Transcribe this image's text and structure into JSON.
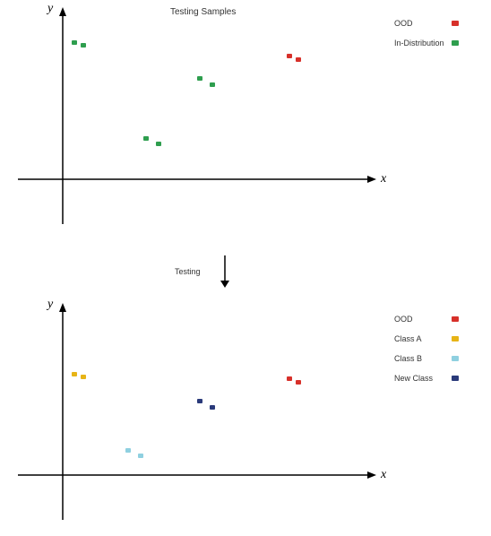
{
  "chart_data": [
    {
      "type": "scatter",
      "title": "Testing Samples",
      "xlabel": "x",
      "ylabel": "y",
      "xlim": [
        -3,
        12
      ],
      "ylim": [
        -3,
        7
      ],
      "series": [
        {
          "name": "OOD",
          "color": "#d7302a",
          "points": [
            [
              9.2,
              4.3
            ],
            [
              9.6,
              4.1
            ]
          ]
        },
        {
          "name": "In-Distribution",
          "color": "#2e9e4e",
          "points": [
            [
              -1.5,
              5.1
            ],
            [
              -1.1,
              5.0
            ],
            [
              5.2,
              3.5
            ],
            [
              5.8,
              3.2
            ],
            [
              2.7,
              0.9
            ],
            [
              3.3,
              0.7
            ]
          ]
        }
      ]
    },
    {
      "type": "scatter",
      "title": "",
      "xlabel": "x",
      "ylabel": "y",
      "xlim": [
        -3,
        12
      ],
      "ylim": [
        -3,
        7
      ],
      "series": [
        {
          "name": "OOD",
          "color": "#d7302a",
          "points": [
            [
              9.2,
              4.3
            ],
            [
              9.6,
              4.1
            ]
          ]
        },
        {
          "name": "Class A",
          "color": "#e7b416",
          "points": [
            [
              -1.5,
              5.1
            ],
            [
              -1.1,
              5.0
            ]
          ]
        },
        {
          "name": "Class B",
          "color": "#8fd0e0",
          "points": [
            [
              2.7,
              0.9
            ],
            [
              3.3,
              0.7
            ]
          ]
        },
        {
          "name": "New Class",
          "color": "#2a3a7a",
          "points": [
            [
              5.2,
              3.5
            ],
            [
              5.8,
              3.2
            ]
          ]
        }
      ]
    }
  ],
  "top": {
    "title": "Testing Samples",
    "xlabel": "x",
    "ylabel": "y",
    "legend": [
      {
        "label": "OOD",
        "class": "ood"
      },
      {
        "label": "In-Distribution",
        "class": "id"
      }
    ]
  },
  "bottom": {
    "xlabel": "x",
    "ylabel": "y",
    "legend": [
      {
        "label": "OOD",
        "class": "ood"
      },
      {
        "label": "Class A",
        "class": "ca"
      },
      {
        "label": "Class B",
        "class": "cb"
      },
      {
        "label": "New Class",
        "class": "nc"
      }
    ]
  },
  "transition": {
    "label": "Testing"
  }
}
